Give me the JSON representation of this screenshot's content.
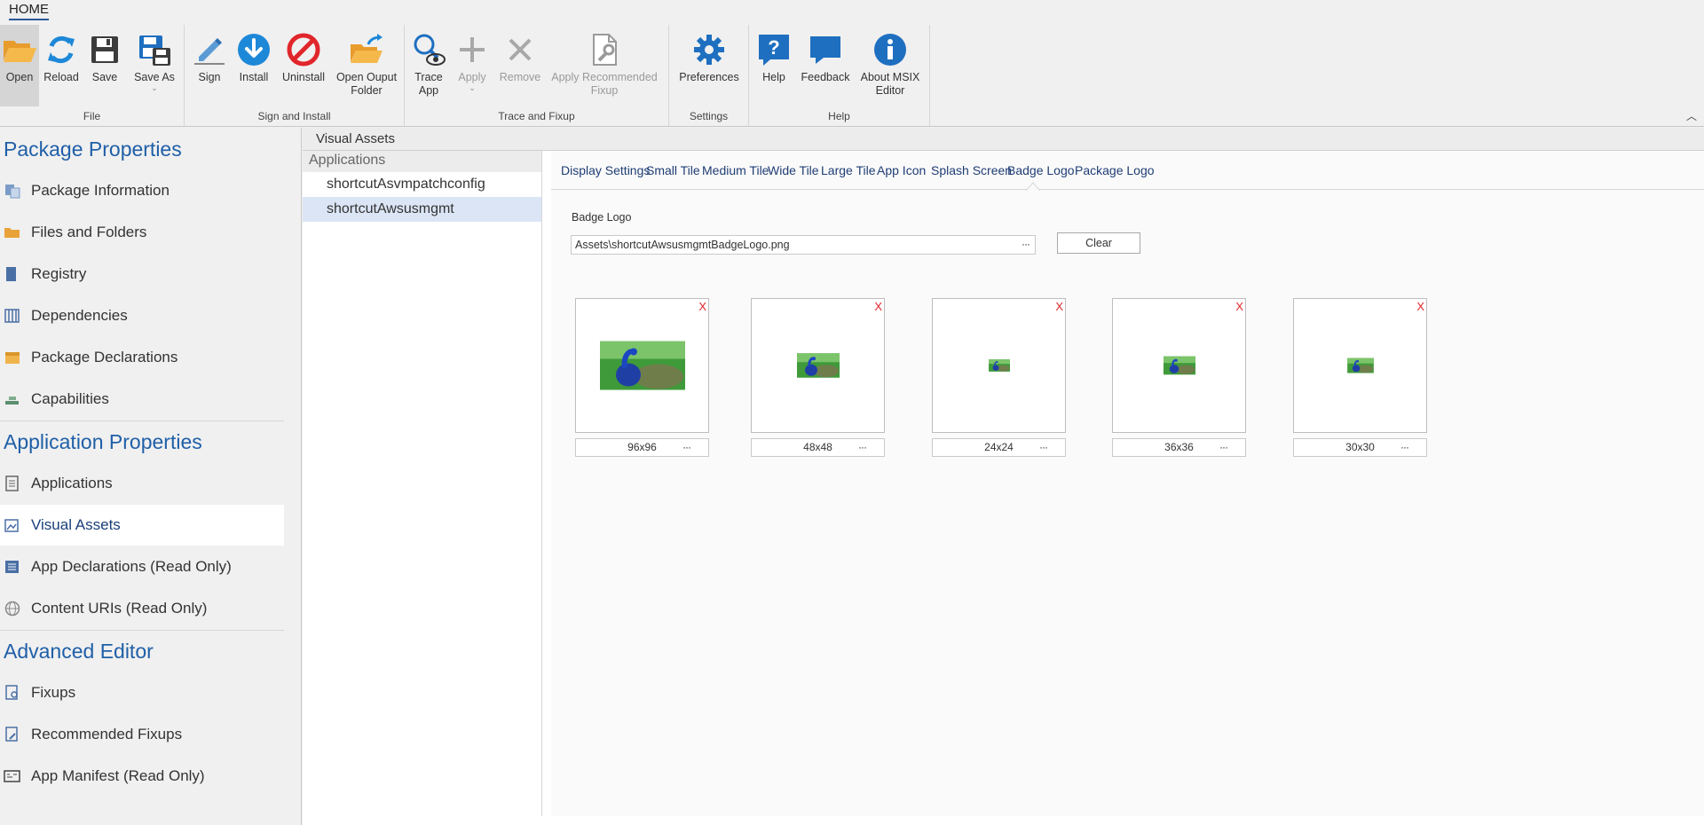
{
  "ribbon": {
    "tab": "HOME",
    "groups": {
      "file": {
        "label": "File",
        "open": "Open",
        "reload": "Reload",
        "save": "Save",
        "save_as": "Save As"
      },
      "sign": {
        "label": "Sign and Install",
        "sign": "Sign",
        "install": "Install",
        "uninstall": "Uninstall",
        "open_output_line1": "Open Ouput",
        "open_output_line2": "Folder"
      },
      "trace": {
        "label": "Trace and Fixup",
        "trace_line1": "Trace",
        "trace_line2": "App",
        "apply": "Apply",
        "remove": "Remove",
        "apply_rec_line1": "Apply Recommended",
        "apply_rec_line2": "Fixup"
      },
      "settings": {
        "label": "Settings",
        "preferences": "Preferences"
      },
      "help": {
        "label": "Help",
        "help": "Help",
        "feedback": "Feedback",
        "about_line1": "About MSIX",
        "about_line2": "Editor"
      }
    }
  },
  "nav": {
    "package_title": "Package Properties",
    "package_items": [
      "Package Information",
      "Files and Folders",
      "Registry",
      "Dependencies",
      "Package Declarations",
      "Capabilities"
    ],
    "application_title": "Application Properties",
    "application_items": [
      "Applications",
      "Visual Assets",
      "App Declarations (Read Only)",
      "Content URIs (Read Only)"
    ],
    "advanced_title": "Advanced Editor",
    "advanced_items": [
      "Fixups",
      "Recommended Fixups",
      "App Manifest (Read Only)"
    ]
  },
  "main": {
    "header": "Visual Assets",
    "apps_header": "Applications",
    "apps": [
      "shortcutAsvmpatchconfig",
      "shortcutAwsusmgmt"
    ],
    "subtabs": [
      "Display Settings",
      "Small Tile",
      "Medium Tile",
      "Wide Tile",
      "Large Tile",
      "App Icon",
      "Splash Screen",
      "Badge Logo",
      "Package Logo"
    ],
    "active_subtab": "Badge Logo",
    "field_label": "Badge Logo",
    "path_value": "Assets\\shortcutAwsusmgmtBadgeLogo.png",
    "clear_label": "Clear",
    "ellipsis": "···",
    "remove_mark": "X",
    "assets": [
      "96x96",
      "48x48",
      "24x24",
      "36x36",
      "30x30"
    ]
  },
  "colors": {
    "accent": "#1f5fa8",
    "remove": "#e0262b",
    "selected_app": "#dbe5f5"
  }
}
